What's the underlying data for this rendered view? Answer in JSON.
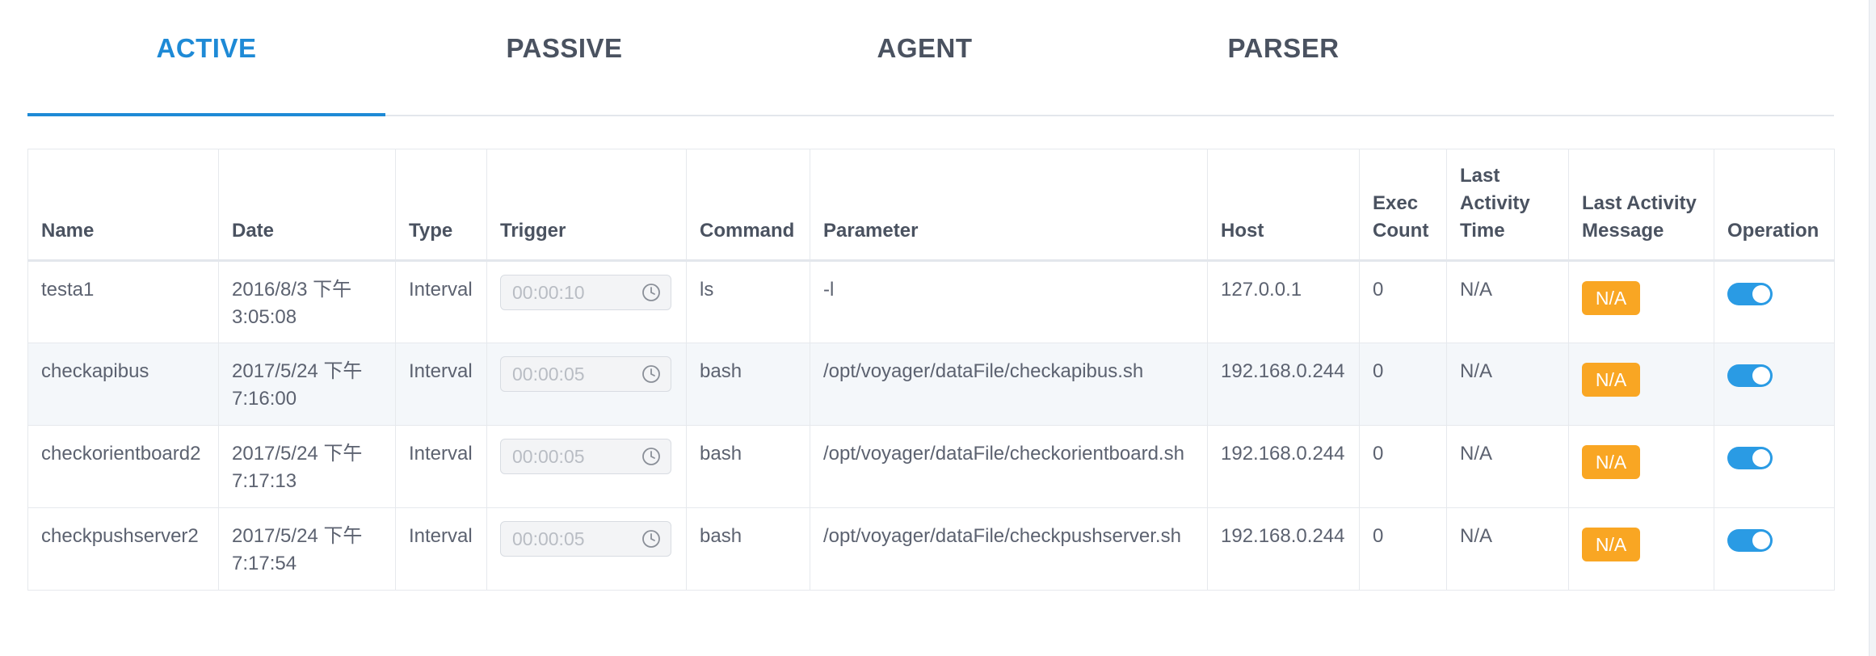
{
  "tabs": [
    {
      "label": "ACTIVE",
      "active": true
    },
    {
      "label": "PASSIVE",
      "active": false
    },
    {
      "label": "AGENT",
      "active": false
    },
    {
      "label": "PARSER",
      "active": false
    }
  ],
  "table": {
    "headers": {
      "name": "Name",
      "date": "Date",
      "type": "Type",
      "trigger": "Trigger",
      "command": "Command",
      "parameter": "Parameter",
      "host": "Host",
      "exec_count": "Exec Count",
      "last_activity_time": "Last Activity Time",
      "last_activity_message": "Last Activity Message",
      "operation": "Operation"
    },
    "rows": [
      {
        "name": "testa1",
        "date": "2016/8/3 下午 3:05:08",
        "type": "Interval",
        "trigger": "00:00:10",
        "command": "ls",
        "parameter": "-l",
        "host": "127.0.0.1",
        "exec_count": "0",
        "last_activity_time": "N/A",
        "last_activity_message": "N/A",
        "enabled": true
      },
      {
        "name": "checkapibus",
        "date": "2017/5/24 下午 7:16:00",
        "type": "Interval",
        "trigger": "00:00:05",
        "command": "bash",
        "parameter": "/opt/voyager/dataFile/checkapibus.sh",
        "host": "192.168.0.244",
        "exec_count": "0",
        "last_activity_time": "N/A",
        "last_activity_message": "N/A",
        "enabled": true
      },
      {
        "name": "checkorientboard2",
        "date": "2017/5/24 下午 7:17:13",
        "type": "Interval",
        "trigger": "00:00:05",
        "command": "bash",
        "parameter": "/opt/voyager/dataFile/checkorientboard.sh",
        "host": "192.168.0.244",
        "exec_count": "0",
        "last_activity_time": "N/A",
        "last_activity_message": "N/A",
        "enabled": true
      },
      {
        "name": "checkpushserver2",
        "date": "2017/5/24 下午 7:17:54",
        "type": "Interval",
        "trigger": "00:00:05",
        "command": "bash",
        "parameter": "/opt/voyager/dataFile/checkpushserver.sh",
        "host": "192.168.0.244",
        "exec_count": "0",
        "last_activity_time": "N/A",
        "last_activity_message": "N/A",
        "enabled": true
      }
    ]
  },
  "colors": {
    "accent": "#1e8ad6",
    "badge": "#f9a623",
    "toggle_on": "#2a9be4"
  },
  "icons": {
    "trigger_icon": "clock-icon"
  }
}
